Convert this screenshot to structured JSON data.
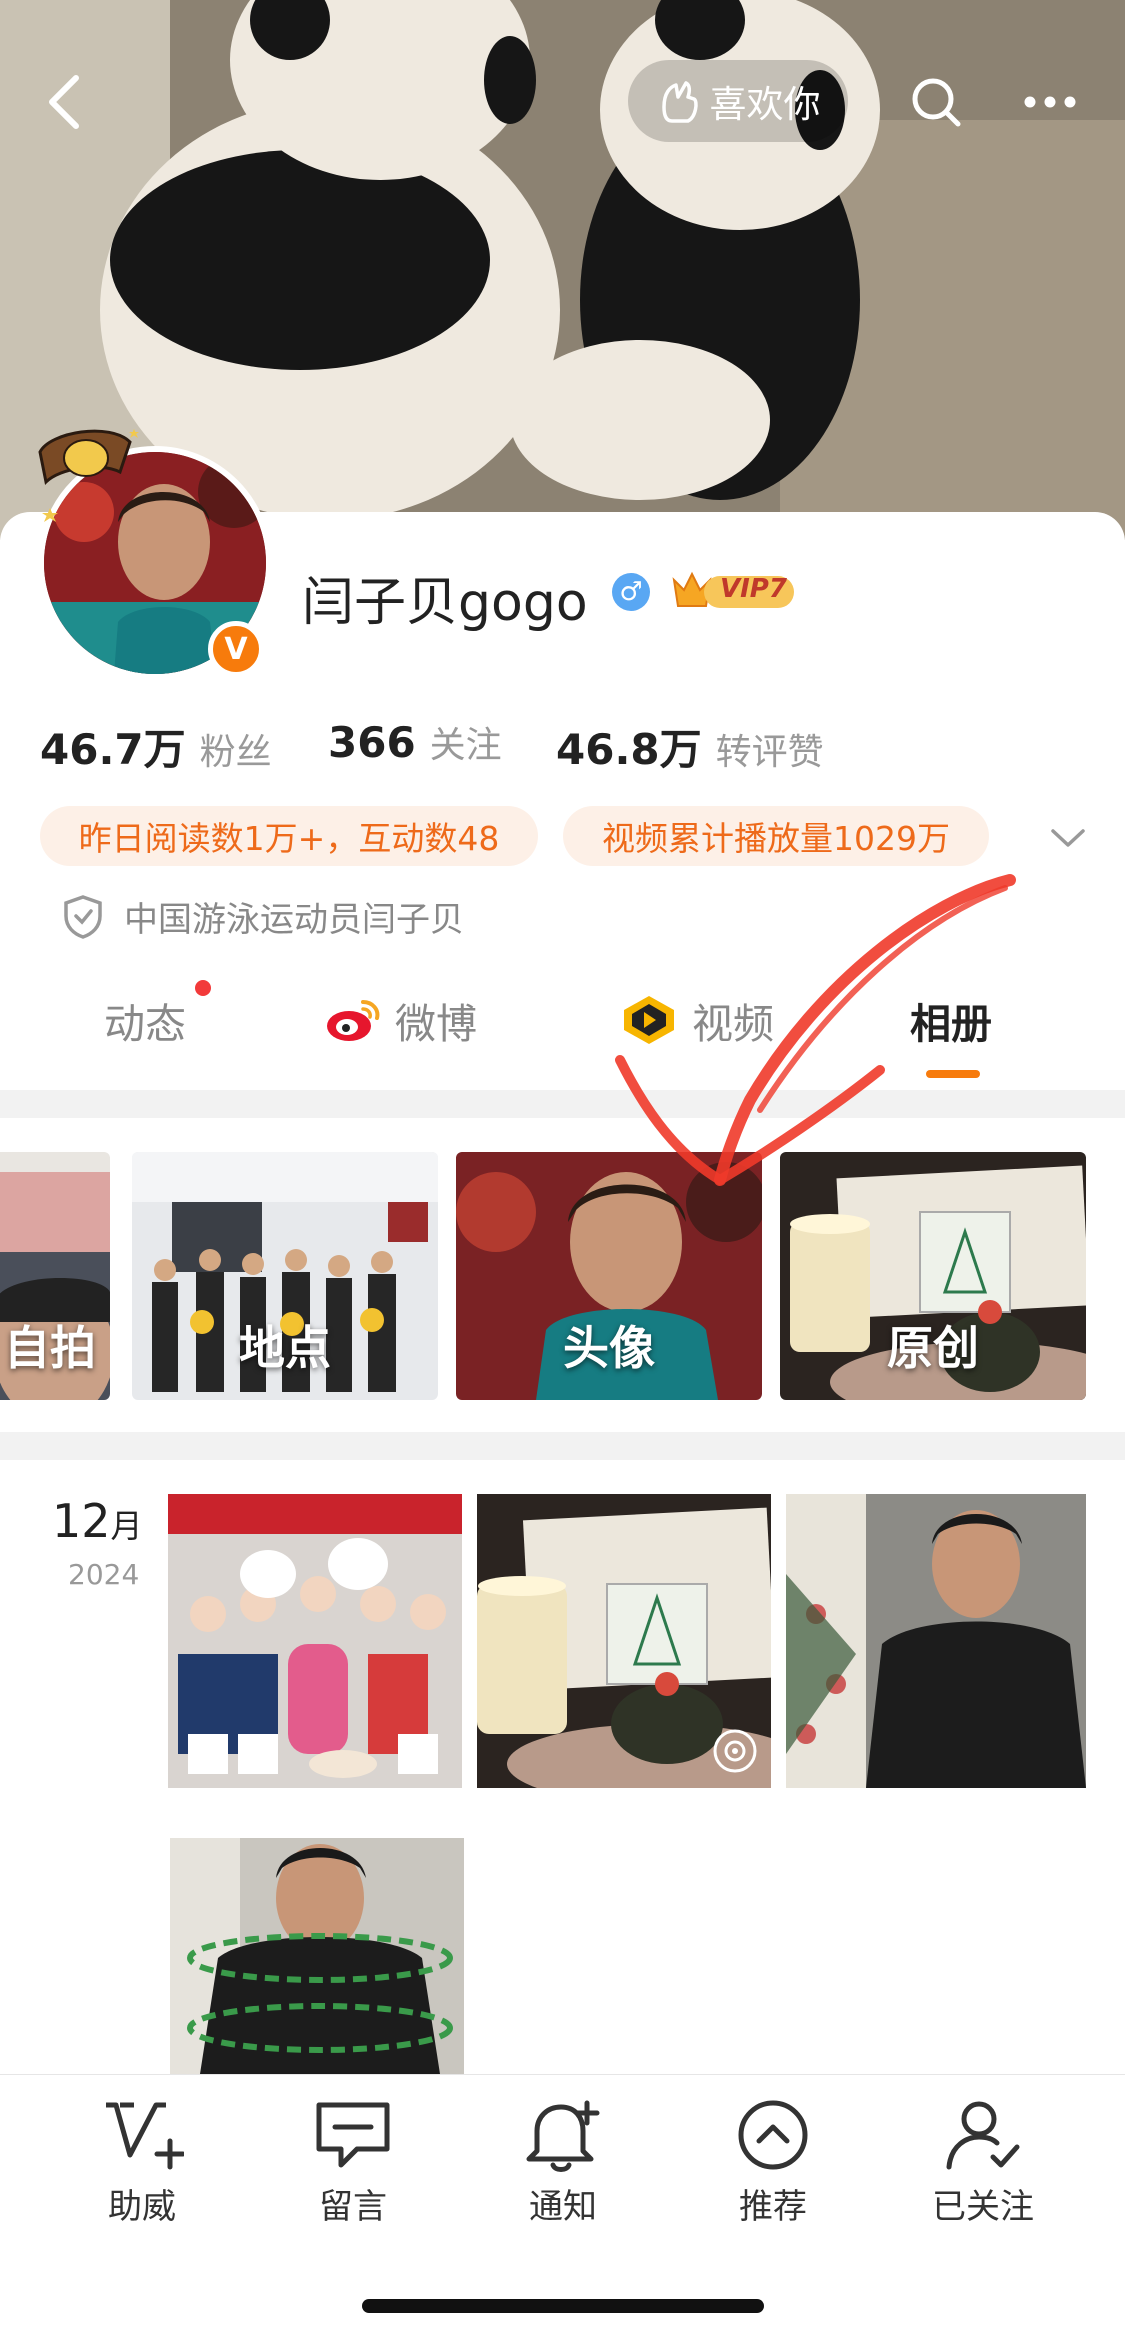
{
  "header": {
    "like_label": "喜欢你",
    "back_icon": "chevron-left-icon",
    "search_icon": "search-icon",
    "more_icon": "more-icon"
  },
  "profile": {
    "name": "闫子贝gogo",
    "gender_symbol": "♂",
    "vip_label": "VIP7",
    "verified_badge": "V",
    "stats": [
      {
        "value": "46.7万",
        "label": "粉丝"
      },
      {
        "value": "366",
        "label": "关注"
      },
      {
        "value": "46.8万",
        "label": "转评赞"
      }
    ],
    "tags": [
      "昨日阅读数1万+，互动数48",
      "视频累计播放量1029万"
    ],
    "bio": "中国游泳运动员闫子贝"
  },
  "tabs": [
    {
      "label": "动态"
    },
    {
      "label": "微博"
    },
    {
      "label": "视频"
    },
    {
      "label": "相册"
    }
  ],
  "active_tab": "相册",
  "albums": [
    {
      "label": "自拍"
    },
    {
      "label": "地点"
    },
    {
      "label": "头像"
    },
    {
      "label": "原创"
    }
  ],
  "timeline": {
    "month": "12",
    "month_unit": "月",
    "year": "2024"
  },
  "bottom_nav": [
    {
      "label": "助威",
      "icon": "cheer-icon"
    },
    {
      "label": "留言",
      "icon": "message-icon"
    },
    {
      "label": "通知",
      "icon": "bell-plus-icon"
    },
    {
      "label": "推荐",
      "icon": "recommend-icon"
    },
    {
      "label": "已关注",
      "icon": "followed-user-icon"
    }
  ],
  "colors": {
    "accent": "#f77b0c",
    "tag_text": "#ee6a1a",
    "tag_bg": "#fdf0e7",
    "annotation": "#ef3a2a"
  }
}
